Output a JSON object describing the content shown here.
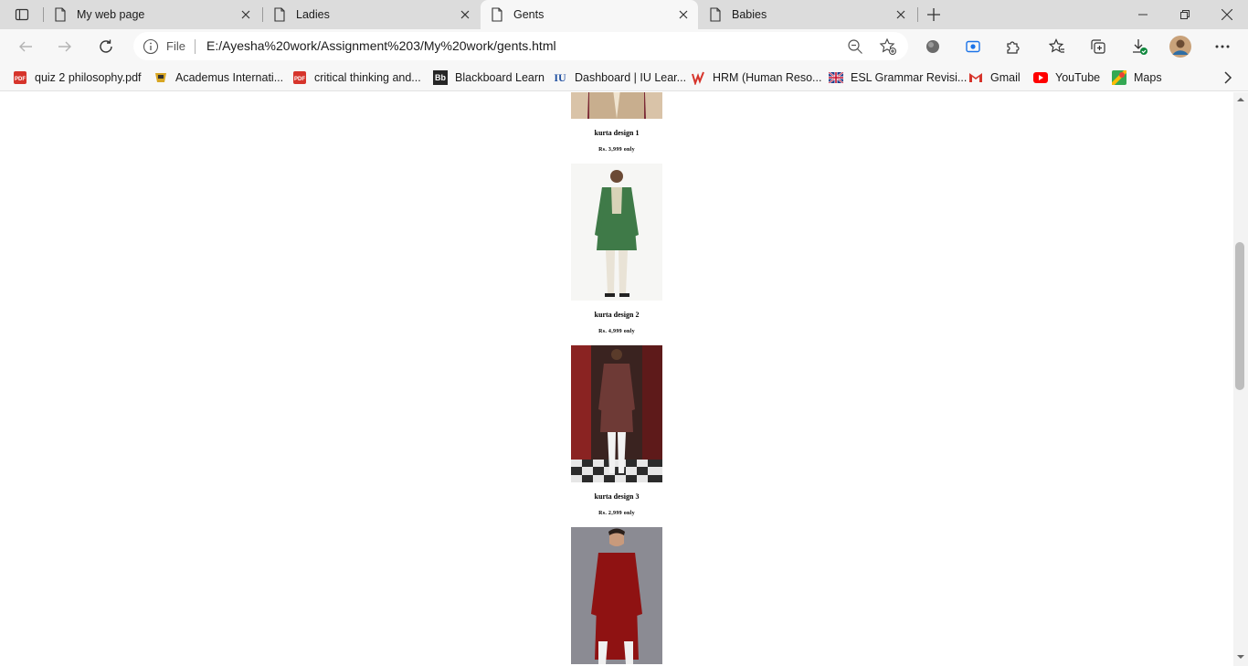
{
  "tabs": [
    {
      "title": "My web page",
      "active": false
    },
    {
      "title": "Ladies",
      "active": false
    },
    {
      "title": "Gents",
      "active": true
    },
    {
      "title": "Babies",
      "active": false
    }
  ],
  "omnibox": {
    "scheme_label": "File",
    "url": "E:/Ayesha%20work/Assignment%203/My%20work/gents.html"
  },
  "bookmarks": [
    {
      "label": "quiz 2 philosophy.pdf",
      "icon": "pdf-icon"
    },
    {
      "label": "Academus Internati...",
      "icon": "academus-icon"
    },
    {
      "label": "critical thinking and...",
      "icon": "pdf-icon"
    },
    {
      "label": "Blackboard Learn",
      "icon": "blackboard-icon",
      "icon_text": "Bb"
    },
    {
      "label": "Dashboard | IU Lear...",
      "icon": "iu-icon",
      "icon_text": "IU"
    },
    {
      "label": "HRM (Human Reso...",
      "icon": "hrm-icon"
    },
    {
      "label": "ESL Grammar Revisi...",
      "icon": "uk-flag-icon"
    },
    {
      "label": "Gmail",
      "icon": "gmail-icon"
    },
    {
      "label": "YouTube",
      "icon": "youtube-icon"
    },
    {
      "label": "Maps",
      "icon": "maps-icon"
    }
  ],
  "products": [
    {
      "name": "kurta design 1",
      "price": "Rs. 3,999 only",
      "color": "#7b2a36"
    },
    {
      "name": "kurta design 2",
      "price": "Rs. 4,999 only",
      "color": "#3f7a48"
    },
    {
      "name": "kurta design 3",
      "price": "Rs. 2,999 only",
      "color": "#6e3a36"
    },
    {
      "name": "",
      "price": "",
      "color": "#8f1212"
    }
  ]
}
